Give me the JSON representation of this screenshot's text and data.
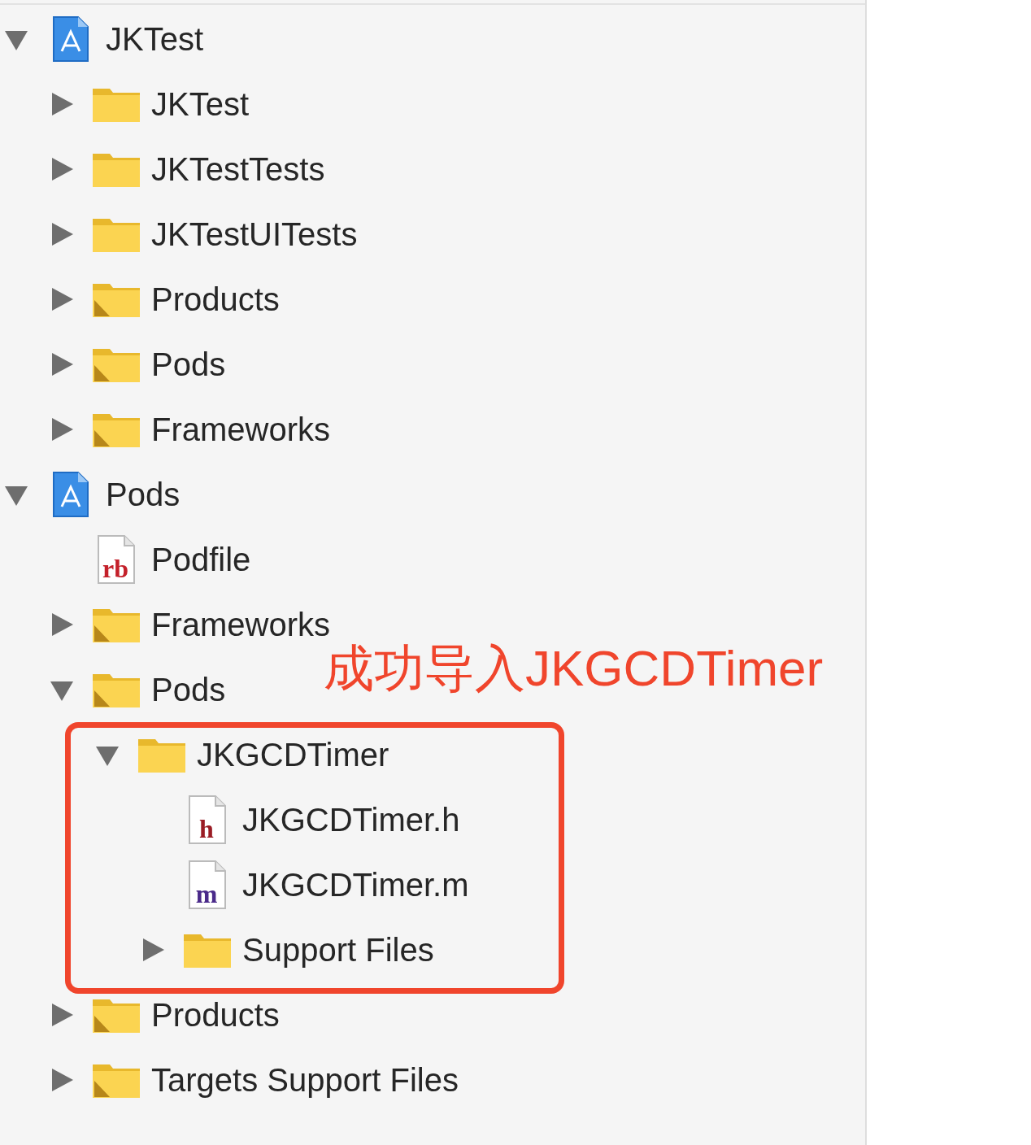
{
  "tree": [
    {
      "label": "JKTest",
      "kind": "project",
      "expanded": true,
      "children": [
        {
          "label": "JKTest",
          "kind": "folder",
          "expanded": false
        },
        {
          "label": "JKTestTests",
          "kind": "folder",
          "expanded": false
        },
        {
          "label": "JKTestUITests",
          "kind": "folder",
          "expanded": false
        },
        {
          "label": "Products",
          "kind": "group",
          "expanded": false
        },
        {
          "label": "Pods",
          "kind": "group",
          "expanded": false
        },
        {
          "label": "Frameworks",
          "kind": "group",
          "expanded": false
        }
      ]
    },
    {
      "label": "Pods",
      "kind": "project",
      "expanded": true,
      "children": [
        {
          "label": "Podfile",
          "kind": "file",
          "file_type": "rb",
          "color": "#c4202a"
        },
        {
          "label": "Frameworks",
          "kind": "group",
          "expanded": false
        },
        {
          "label": "Pods",
          "kind": "group",
          "expanded": true,
          "children": [
            {
              "label": "JKGCDTimer",
              "kind": "folder",
              "expanded": true,
              "children": [
                {
                  "label": "JKGCDTimer.h",
                  "kind": "file",
                  "file_type": "h",
                  "color": "#9a1c24"
                },
                {
                  "label": "JKGCDTimer.m",
                  "kind": "file",
                  "file_type": "m",
                  "color": "#4a2a8a"
                },
                {
                  "label": "Support Files",
                  "kind": "folder",
                  "expanded": false
                }
              ]
            }
          ]
        },
        {
          "label": "Products",
          "kind": "group",
          "expanded": false
        },
        {
          "label": "Targets Support Files",
          "kind": "group",
          "expanded": false
        }
      ]
    }
  ],
  "annotation": {
    "text": "成功导入JKGCDTimer"
  }
}
